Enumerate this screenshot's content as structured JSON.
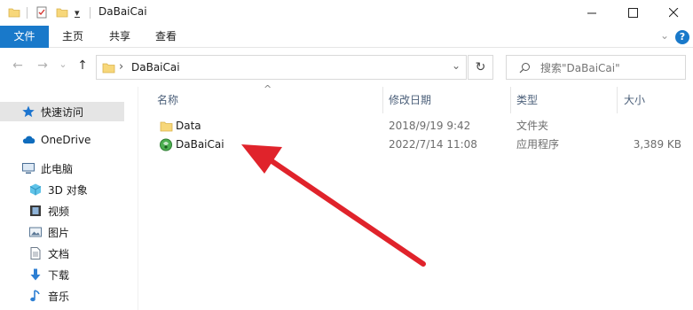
{
  "window": {
    "title": "DaBaiCai",
    "minimize_glyph": "—",
    "maximize_glyph": "☐",
    "close_glyph": "✕"
  },
  "quick_access_toolbar": {
    "dropdown_glyph": "▾"
  },
  "ribbon": {
    "tabs": [
      {
        "label": "文件",
        "active": true
      },
      {
        "label": "主页"
      },
      {
        "label": "共享"
      },
      {
        "label": "查看"
      }
    ],
    "help_label": "?",
    "collapse_glyph": "⌄"
  },
  "navigation": {
    "back_glyph": "←",
    "forward_glyph": "→",
    "recent_glyph": "⌄",
    "up_glyph": "↑",
    "path_separator": "›",
    "path": "DaBaiCai",
    "address_dropdown_glyph": "⌄",
    "refresh_glyph": "↻"
  },
  "search": {
    "placeholder": "搜索\"DaBaiCai\""
  },
  "nav_pane": {
    "items": [
      {
        "label": "快速访问",
        "icon": "star-icon",
        "selected": true
      },
      {
        "label": "OneDrive",
        "icon": "cloud-icon"
      },
      {
        "label": "此电脑",
        "icon": "computer-icon"
      },
      {
        "label": "3D 对象",
        "icon": "cube-icon"
      },
      {
        "label": "视频",
        "icon": "video-icon"
      },
      {
        "label": "图片",
        "icon": "picture-icon"
      },
      {
        "label": "文档",
        "icon": "document-icon"
      },
      {
        "label": "下载",
        "icon": "download-icon"
      },
      {
        "label": "音乐",
        "icon": "music-icon"
      }
    ]
  },
  "file_list": {
    "columns": [
      "名称",
      "修改日期",
      "类型",
      "大小"
    ],
    "sort_glyph": "^",
    "rows": [
      {
        "name": "Data",
        "modified": "2018/9/19 9:42",
        "type": "文件夹",
        "size": "",
        "icon": "folder-icon"
      },
      {
        "name": "DaBaiCai",
        "modified": "2022/7/14 11:08",
        "type": "应用程序",
        "size": "3,389 KB",
        "icon": "app-icon"
      }
    ]
  },
  "annotation": {
    "arrow_color": "#e0232b"
  }
}
